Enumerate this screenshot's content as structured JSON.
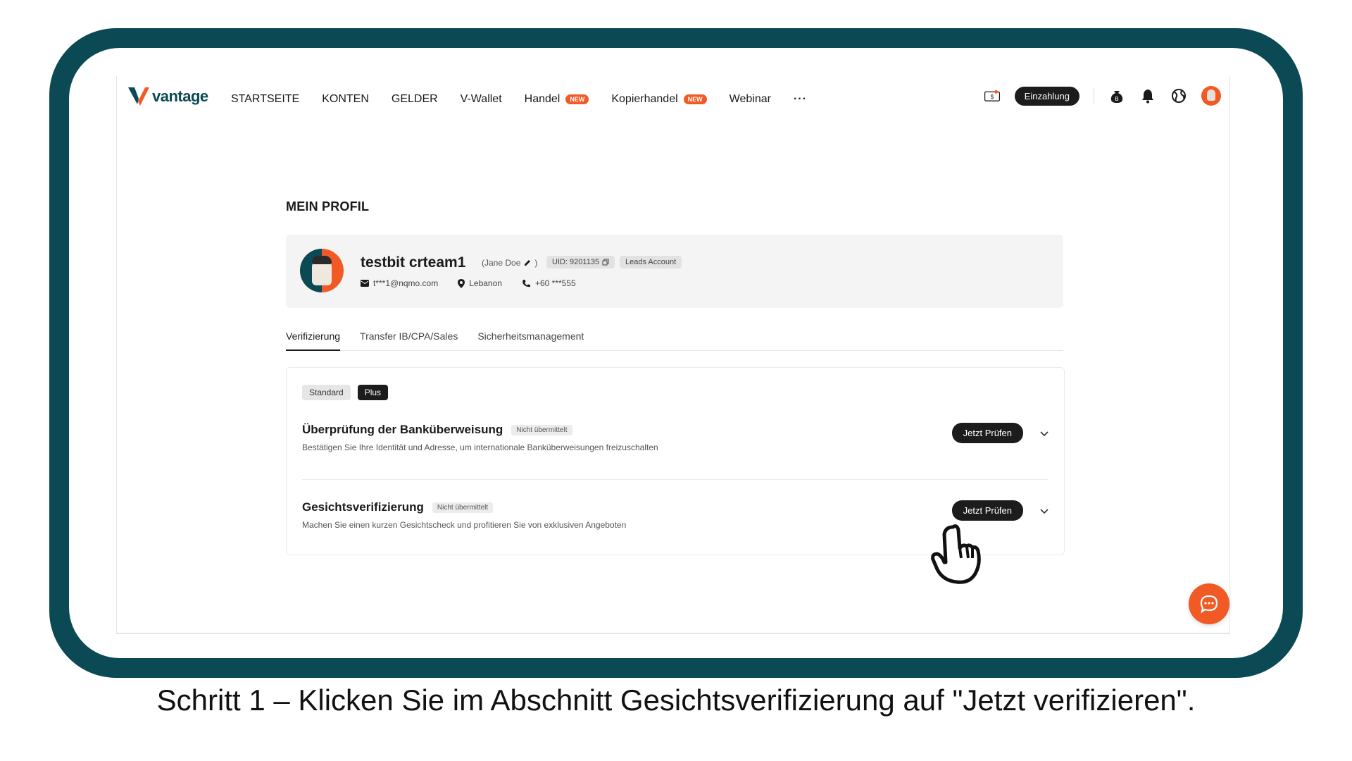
{
  "brand": {
    "logo_text": "vantage",
    "accent": "#f15a24",
    "frame_color": "#0b4a55"
  },
  "nav": {
    "items": [
      {
        "label": "STARTSEITE"
      },
      {
        "label": "KONTEN"
      },
      {
        "label": "GELDER"
      },
      {
        "label": "V-Wallet"
      },
      {
        "label": "Handel",
        "badge": "NEW"
      },
      {
        "label": "Kopierhandel",
        "badge": "NEW"
      },
      {
        "label": "Webinar"
      }
    ],
    "more_label": "···",
    "deposit_label": "Einzahlung",
    "icons": [
      "rewards-ticket-icon",
      "bitcoin-bag-icon",
      "bell-icon",
      "globe-icon",
      "user-avatar"
    ]
  },
  "page": {
    "title": "MEIN PROFIL"
  },
  "profile": {
    "name": "testbit crteam1",
    "real_name": "(Jane Doe",
    "uid": "UID: 9201135",
    "account_type": "Leads Account",
    "email": "t***1@nqmo.com",
    "country": "Lebanon",
    "phone": "+60 ***555"
  },
  "tabs": [
    {
      "label": "Verifizierung",
      "active": true
    },
    {
      "label": "Transfer IB/CPA/Sales",
      "active": false
    },
    {
      "label": "Sicherheitsmanagement",
      "active": false
    }
  ],
  "verification": {
    "levels": {
      "standard": "Standard",
      "plus": "Plus",
      "selected": "Plus"
    },
    "items": [
      {
        "title": "Überprüfung der Banküberweisung",
        "status": "Nicht übermittelt",
        "description": "Bestätigen Sie Ihre Identität und Adresse, um internationale Banküberweisungen freizuschalten",
        "button": "Jetzt Prüfen"
      },
      {
        "title": "Gesichtsverifizierung",
        "status": "Nicht übermittelt",
        "description": "Machen Sie einen kurzen Gesichtscheck und profitieren Sie von exklusiven Angeboten",
        "button": "Jetzt Prüfen"
      }
    ]
  },
  "caption": "Schritt 1 – Klicken Sie im Abschnitt Gesichtsverifizierung auf \"Jetzt verifizieren\"."
}
